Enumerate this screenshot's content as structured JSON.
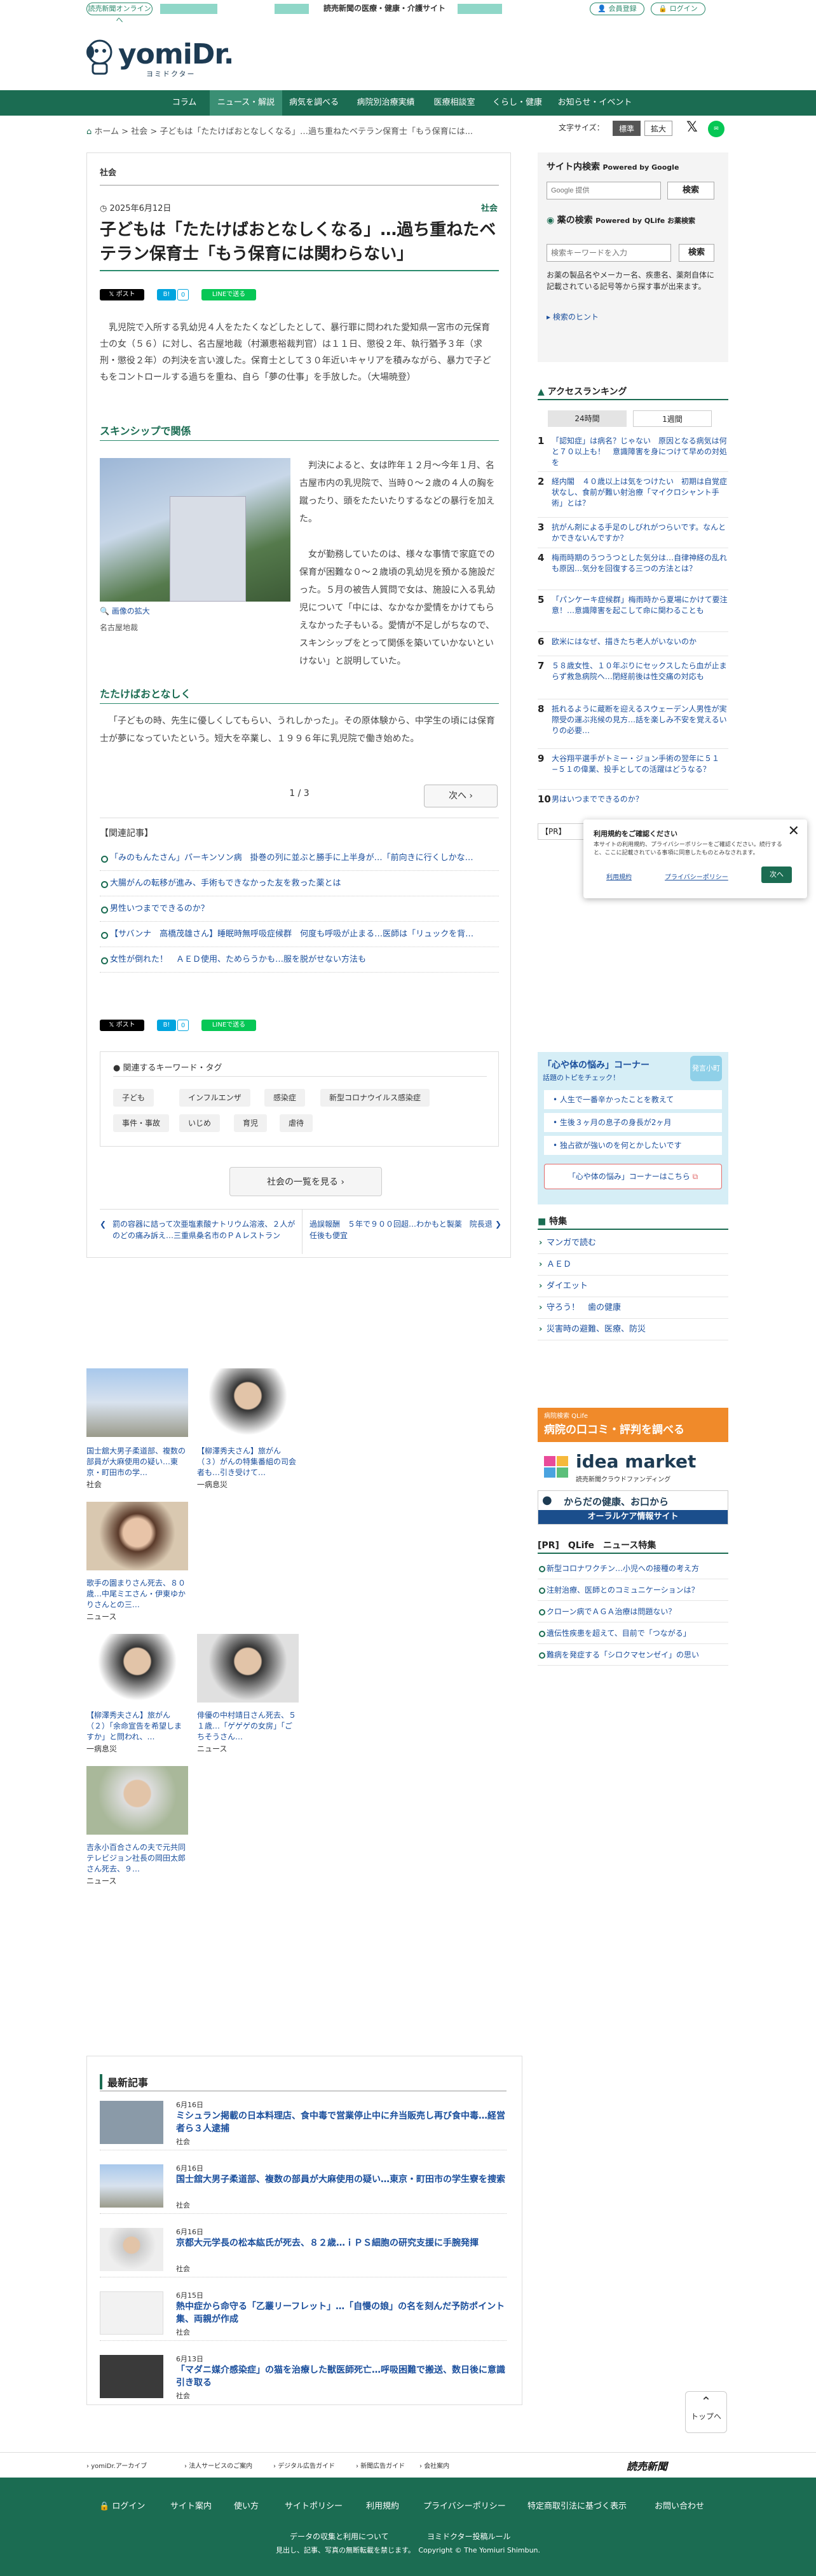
{
  "top": {
    "yomiuri_online": "読売新聞オンラインへ",
    "tagline": "読売新聞の医療・健康・介護サイト",
    "register": "会員登録",
    "login": "ログイン"
  },
  "logo": {
    "main": "yomiDr.",
    "sub": "ヨミドクター"
  },
  "nav": [
    "コラム",
    "ニュース・解説",
    "病気を調べる",
    "病院別治療実績",
    "医療相談室",
    "くらし・健康",
    "お知らせ・イベント"
  ],
  "breadcrumb": {
    "home": "ホーム",
    "sep": ">",
    "section": "社会",
    "current": "子どもは「たたけばおとなしくなる」…過ち重ねたベテラン保育士「もう保育には..."
  },
  "fontsize": {
    "label": "文字サイズ：",
    "standard": "標準",
    "large": "拡大"
  },
  "article": {
    "section": "社会",
    "date": "2025年6月12日",
    "category": "社会",
    "title": "子どもは「たたけばおとなしくなる」…過ち重ねたベテラン保育士「もう保育には関わらない」",
    "share": {
      "post": "ポスト",
      "b": "B!",
      "b_count": "0",
      "line": "LINEで送る"
    },
    "lead": "乳児院で入所する乳幼児４人をたたくなどしたとして、暴行罪に問われた愛知県一宮市の元保育士の女（５６）に対し、名古屋地裁（村瀬恵裕裁判官）は１１日、懲役２年、執行猶予３年（求刑・懲役２年）の判決を言い渡した。保育士として３０年近いキャリアを積みながら、暴力で子どもをコントロールする過ちを重ね、自ら「夢の仕事」を手放した。（大場暁登）",
    "sub1": "スキンシップで関係",
    "p1": "判決によると、女は昨年１２月～今年１月、名古屋市内の乳児院で、当時０～２歳の４人の胸を蹴ったり、頭をたたいたりするなどの暴行を加えた。",
    "p2": "女が勤務していたのは、様々な事情で家庭での保育が困難な０～２歳頃の乳幼児を預かる施設だった。５月の被告人質問で女は、施設に入る乳幼児について「中には、なかなか愛情をかけてもらえなかった子もいる。愛情が不足しがちなので、スキンシップをとって関係を築いていかないといけない」と説明していた。",
    "photo_zoom": "画像の拡大",
    "photo_caption": "名古屋地裁",
    "sub2": "たたけばおとなしく",
    "p3": "「子どもの時、先生に優しくしてもらい、うれしかった」。その原体験から、中学生の頃には保育士が夢になっていたという。短大を卒業し、１９９６年に乳児院で働き始めた。",
    "pager": "1 / 3",
    "next": "次へ",
    "related_title": "【関連記事】",
    "related": [
      "「みのもんたさん」パーキンソン病　掛巻の列に並ぶと勝手に上半身が…「前向きに行くしかな…",
      "大腸がんの転移が進み、手術もできなかった友を救った薬とは",
      "男性いつまでできるのか？",
      "【サバンナ　高橋茂雄さん】睡眠時無呼吸症候群　何度も呼吸が止まる…医師は「リュックを背…",
      "女性が倒れた！　ＡＥＤ使用、ためらうかも…服を脱がせない方法も"
    ],
    "keywords_title": "関連するキーワード・タグ",
    "keywords": [
      "子ども",
      "インフルエンザ",
      "感染症",
      "新型コロナウイルス感染症",
      "事件・事故",
      "いじめ",
      "育児",
      "虐待"
    ],
    "list_button": "社会の一覧を見る",
    "prev_article": "罰の容器に詰って次亜塩素酸ナトリウム溶液、２人がのどの痛み訴え…三重県桑名市のＰＡレストラン",
    "next_article": "過誤報酬　５年で９００回超…わかもと製薬　院長退任後も便宜"
  },
  "side": {
    "search_title": "サイト内検索",
    "search_powered": "Powered by Google",
    "google_placeholder": "Google 提供",
    "search_btn": "検索",
    "drug_title": "薬の検索",
    "drug_powered": "Powered by QLife お薬検索",
    "drug_placeholder": "検索キーワードを入力",
    "drug_btn": "検索",
    "drug_desc": "お薬の製品名やメーカー名、疾患名、薬剤自体に記載されている記号等から探す事が出来ます。",
    "drug_hint": "検索のヒント",
    "ranking_title": "アクセスランキング",
    "ranking_tabs": [
      "24時間",
      "1週間"
    ],
    "ranking": [
      "「認知症」は病名？じゃない　原因となる病気は何と７０以上も！　意識障害を身につけて早めの対処を",
      "経内閣　４０歳以上は気をつけたい　初期は自覚症状なし、食前が難い射治療「マイクロシャント手術」とは？",
      "抗がん剤による手足のしびれがつらいです。なんとかできないんですか？",
      "梅雨時期のうつうつとした気分は…自律神経の乱れも原因…気分を回復する三つの方法とは？",
      "「パンケーキ症候群」梅雨時から夏場にかけて要注意！…意識障害を起こして命に関わることも",
      "欧米にはなぜ、描きたち老人がいないのか",
      "５８歳女性、１０年ぶりにセックスしたら血が止まらず救急病院へ…閉経前後は性交痛の対応も",
      "抵れるように蔵断を迎えるスウェーデン人男性が実際受の運ぶ兆候の見方…話を楽しみ不安を覚えるいりの必要…",
      "大谷翔平選手がトミー・ジョン手術の翌年に５１−５１の偉業、投手としての活躍はどうなる？",
      "男はいつまでできるのか？"
    ],
    "pr_label": "【PR】",
    "kokoro_title": "「心や体の悩み」コーナー",
    "kokoro_sub": "話題のトピをチェック！",
    "kokoro_badge": "発言小町",
    "kokoro_items": [
      "人生で一番辛かったことを教えて",
      "生後３ヶ月の息子の身長が2ヶ月",
      "独占欲が強いのを何とかしたいです"
    ],
    "kokoro_link": "「心や体の悩み」コーナーはこちら",
    "feature_title": "特集",
    "features": [
      "マンガで読む",
      "ＡＥＤ",
      "ダイエット",
      "守ろう！　歯の健康",
      "災害時の避難、医療、防災"
    ],
    "banner1_top": "病院検索 QLife",
    "banner1": "病院の口コミ・評判を調べる",
    "banner2": "idea market",
    "banner2_sub": "読売新聞クラウドファンディング",
    "banner3": "からだの健康、お口から",
    "banner3_sub": "オーラルケア情報サイト",
    "qlife_title": "[PR]　QLife　ニュース特集",
    "qlife": [
      "新型コロナワクチン…小児への接種の考え方",
      "注射治療、医師とのコミュニケーションは？",
      "クローン病でＡＧＡ治療は問題ない？",
      "遺伝性疾患を超えて、目前で「つながる」",
      "難病を発症する「シロクマセンゼイ」の思い"
    ]
  },
  "grid": [
    {
      "caption": "国士舘大男子柔道部、複数の部員が大麻使用の疑い…東京・町田市の学…",
      "cat": "社会"
    },
    {
      "caption": "【柳澤秀夫さん】旅がん（３）がんの特集番組の司会者も…引き受けて…",
      "cat": "一病息災"
    },
    {
      "caption": "歌手の園まりさん死去、８０歳…中尾ミエさん・伊東ゆかりさんとの三…",
      "cat": "ニュース"
    },
    {
      "caption": "【柳澤秀夫さん】旅がん（２）「余命宣告を希望しますか」と問われ、…",
      "cat": "一病息災"
    },
    {
      "caption": "俳優の中村靖日さん死去、５１歳…「ゲゲゲの女房」「ごちそうさん…",
      "cat": "ニュース"
    },
    {
      "caption": "吉永小百合さんの夫で元共同テレビジョン社長の岡田太郎さん死去、９…",
      "cat": "ニュース"
    }
  ],
  "latest": {
    "title": "最新記事",
    "items": [
      {
        "date": "6月16日",
        "title": "ミシュラン掲載の日本料理店、食中毒で営業停止中に弁当販売し再び食中毒…経営者ら３人逮捕",
        "cat": "社会"
      },
      {
        "date": "6月16日",
        "title": "国士舘大男子柔道部、複数の部員が大麻使用の疑い…東京・町田市の学生寮を捜索",
        "cat": "社会"
      },
      {
        "date": "6月16日",
        "title": "京都大元学長の松本紘氏が死去、８２歳…ｉＰＳ細胞の研究支援に手腕発揮",
        "cat": "社会"
      },
      {
        "date": "6月15日",
        "title": "熱中症から命守る「乙叢リーフレット」…「自慢の娘」の名を刻んだ予防ポイント集、両親が作成",
        "cat": "社会"
      },
      {
        "date": "6月13日",
        "title": "「マダニ媒介感染症」の猫を治療した獣医師死亡…呼吸困難で搬送、数日後に意識引き取る",
        "cat": "社会"
      }
    ]
  },
  "totop": "トップへ",
  "footer": {
    "links1": [
      "yomiDr.アーカイブ",
      "法人サービスのご案内",
      "デジタル広告ガイド",
      "新聞広告ガイド",
      "会社案内"
    ],
    "brand": "読売新聞",
    "links2": [
      "ログイン",
      "サイト案内",
      "使い方",
      "サイトポリシー",
      "利用規約",
      "プライバシーポリシー",
      "特定商取引法に基づく表示",
      "お問い合わせ"
    ],
    "data_policy": "データの収集と利用について",
    "rule": "ヨミドクター投稿ルール",
    "copyright": "見出し、記事、写真の無断転載を禁じます。　Copyright © The Yomiuri Shimbun."
  },
  "popup": {
    "title": "利用規約をご確認ください",
    "body": "本サイトの利用規約、プライバシーポリシーをご確認ください。続行すると、ここに記載されている事項に同意したものとみなされます。",
    "terms": "利用規約",
    "privacy": "プライバシーポリシー",
    "next": "次へ"
  }
}
